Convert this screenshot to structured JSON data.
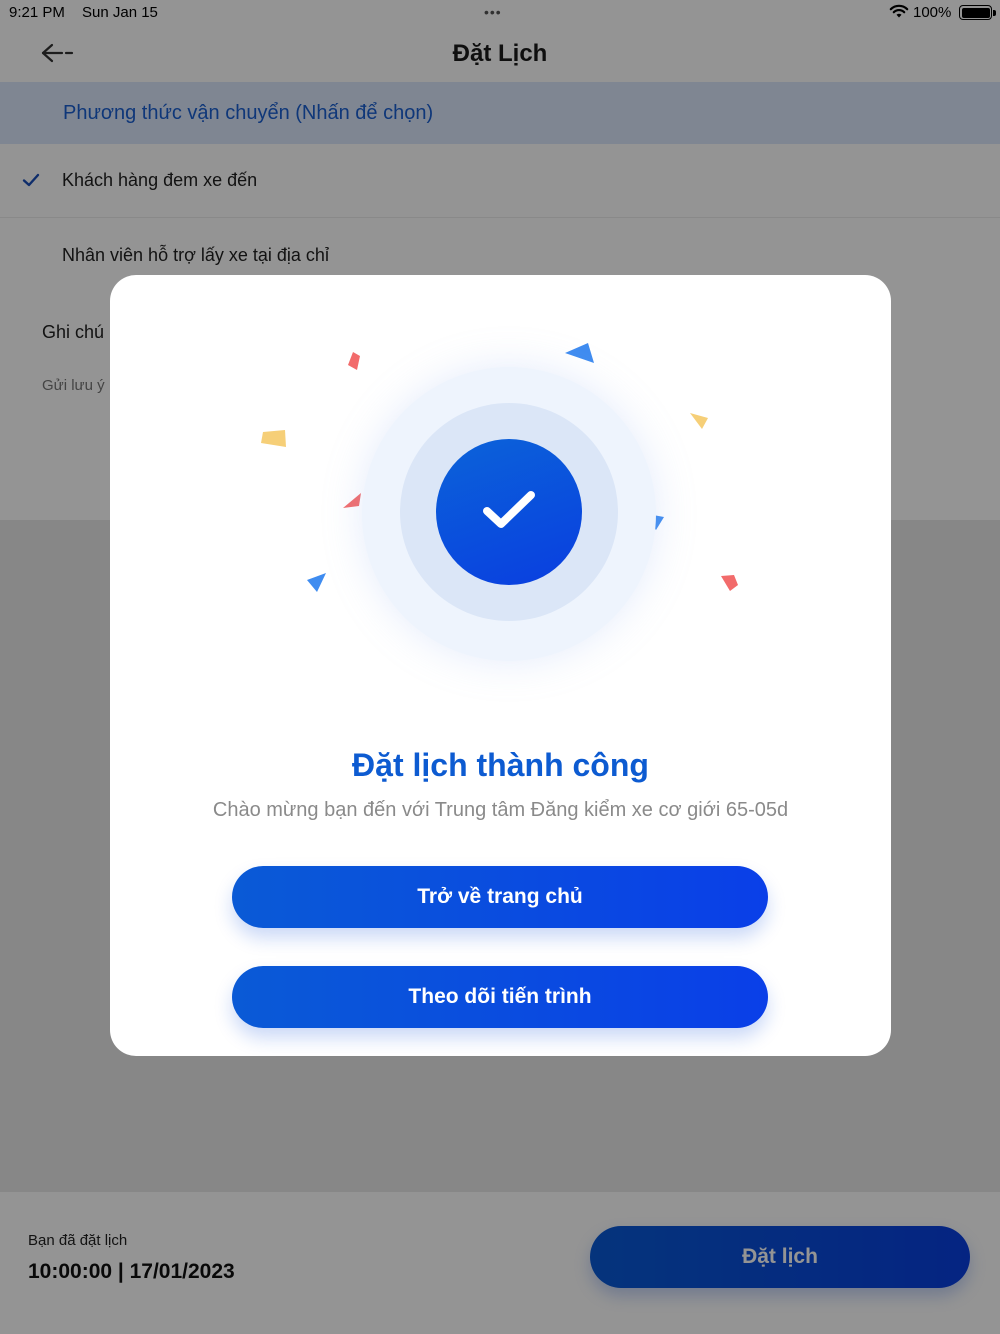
{
  "status_bar": {
    "time": "9:21 PM",
    "date": "Sun Jan 15",
    "dots": "•••",
    "battery": "100%"
  },
  "header": {
    "title": "Đặt Lịch",
    "back_icon": "arrow-left-icon"
  },
  "shipping": {
    "section_title": "Phương thức vận chuyển (Nhấn để chọn)",
    "options": [
      {
        "label": "Khách hàng đem xe đến",
        "selected": true
      },
      {
        "label": "Nhân viên hỗ trợ lấy xe tại địa chỉ",
        "selected": false
      }
    ]
  },
  "note": {
    "label": "Ghi chú",
    "placeholder": "Gửi lưu ý"
  },
  "footer": {
    "subtitle": "Bạn đã đặt lịch",
    "datetime": "10:00:00 | 17/01/2023",
    "book_label": "Đặt lịch"
  },
  "modal": {
    "icon": "check-circle-icon",
    "title": "Đặt lịch thành công",
    "subtitle": "Chào mừng bạn đến với Trung tâm Đăng kiểm xe cơ giới 65-05d",
    "home_label": "Trở về trang chủ",
    "track_label": "Theo dõi tiến trình"
  },
  "colors": {
    "primary": "#0a4fdc",
    "title_blue": "#0d5bd1",
    "section_bg": "#dbe7fb",
    "confetti_red": "#f26b6b",
    "confetti_blue": "#3f8cf0",
    "confetti_yellow": "#f6cf78"
  }
}
